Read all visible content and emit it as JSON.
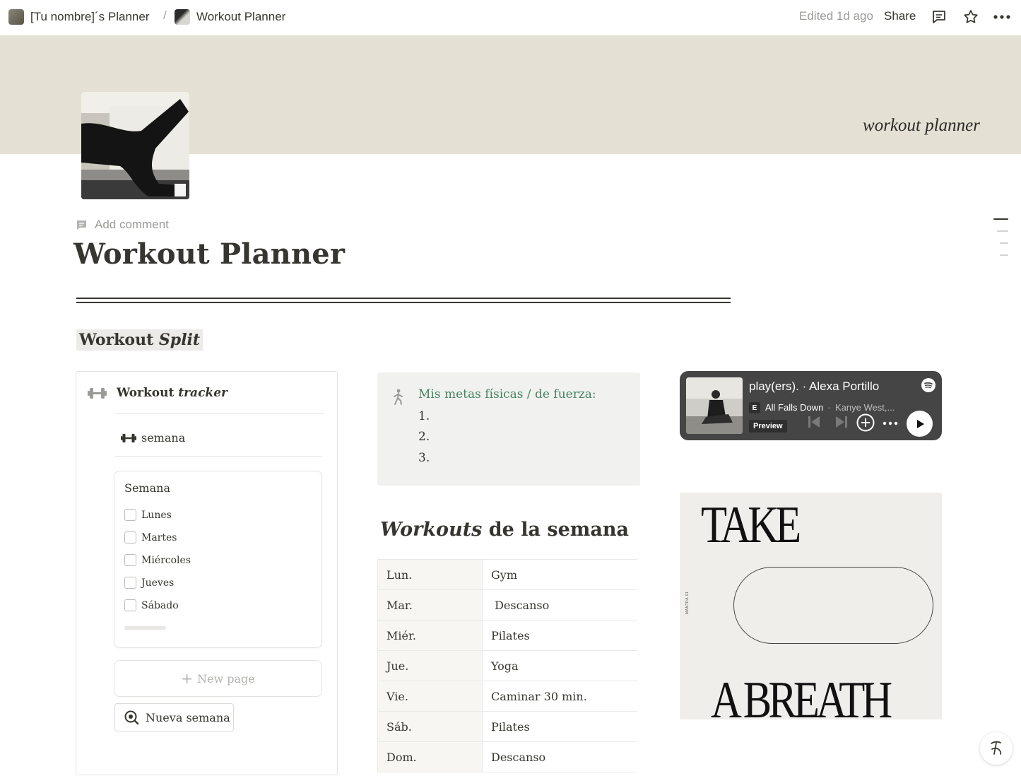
{
  "breadcrumb": {
    "parent": "[Tu nombre]´s Planner",
    "separator": "/",
    "current": "Workout Planner"
  },
  "topbar": {
    "edited": "Edited 1d ago",
    "share": "Share"
  },
  "cover": {
    "caption": "workout planner"
  },
  "add_comment": "Add comment",
  "page_title": "Workout Planner",
  "split_heading": {
    "normal": "Workout ",
    "italic": "Split"
  },
  "tracker": {
    "title_normal": "Workout ",
    "title_italic": "tracker",
    "link": "semana",
    "card_title": "Semana",
    "days": [
      {
        "label": "Lunes",
        "checked": false
      },
      {
        "label": "Martes",
        "checked": false
      },
      {
        "label": "Miércoles",
        "checked": false
      },
      {
        "label": "Jueves",
        "checked": false
      },
      {
        "label": "Sábado",
        "checked": false
      }
    ],
    "new_page": "New page",
    "new_week_button": "Nueva semana"
  },
  "goals": {
    "title": "Mis metas físicas / de fuerza:",
    "items": [
      "1.",
      "2.",
      "3."
    ],
    "title_color": "#448361"
  },
  "workouts": {
    "heading_italic": "Workouts",
    "heading_normal": " de la semana",
    "rows": [
      {
        "day": "Lun.",
        "activity": "Gym"
      },
      {
        "day": "Mar.",
        "activity": " Descanso"
      },
      {
        "day": "Miér.",
        "activity": "Pilates"
      },
      {
        "day": "Jue.",
        "activity": "Yoga"
      },
      {
        "day": "Vie.",
        "activity": "Caminar 30 min."
      },
      {
        "day": "Sáb.",
        "activity": "Pilates"
      },
      {
        "day": "Dom.",
        "activity": "Descanso"
      }
    ]
  },
  "spotify": {
    "title": "play(ers). · Alexa Portillo",
    "explicit": "E",
    "song": "All Falls Down",
    "separator": "·",
    "artist": "Kanye West,...",
    "preview": "Preview"
  },
  "poster": {
    "top": "TAKE",
    "bottom": "A BREATH",
    "side": "MANTRA 01"
  },
  "help_button": "?",
  "colors": {
    "cover": "#e4e0d4",
    "text": "#37352f",
    "muted": "#9b9a97",
    "spotify_bg": "#454545"
  }
}
